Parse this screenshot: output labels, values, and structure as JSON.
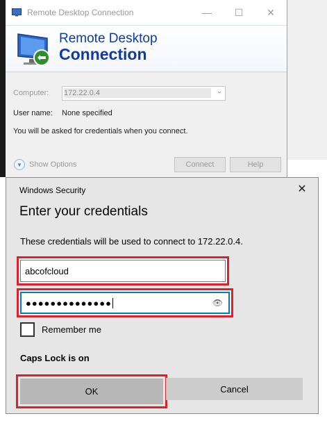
{
  "rdc": {
    "window_title": "Remote Desktop Connection",
    "heading_line1": "Remote Desktop",
    "heading_line2": "Connection",
    "computer_label": "Computer:",
    "computer_value": "172.22.0.4",
    "username_label": "User name:",
    "username_value": "None specified",
    "info_text": "You will be asked for credentials when you connect.",
    "show_options": "Show Options",
    "connect_label": "Connect",
    "help_label": "Help",
    "window_controls": {
      "minimize": "—",
      "maximize": "☐",
      "close": "✕"
    }
  },
  "security": {
    "title": "Windows Security",
    "close_glyph": "✕",
    "heading": "Enter your credentials",
    "description": "These credentials will be used to connect to 172.22.0.4.",
    "username_value": "abcofcloud",
    "password_mask": "●●●●●●●●●●●●●●",
    "reveal_icon_glyph": "👁",
    "remember_label": "Remember me",
    "remember_checked": false,
    "caps_lock_text": "Caps Lock is on",
    "ok_label": "OK",
    "cancel_label": "Cancel"
  },
  "colors": {
    "highlight_red": "#e01f2c",
    "rdc_heading_blue": "#0d3aa8",
    "focus_blue": "#0078d7"
  }
}
